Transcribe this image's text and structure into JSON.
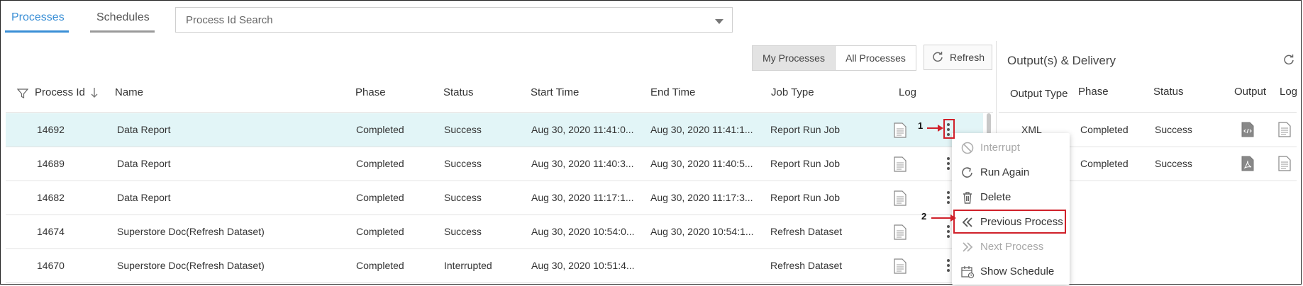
{
  "tabs": [
    {
      "label": "Processes",
      "active": true
    },
    {
      "label": "Schedules",
      "active": false
    }
  ],
  "search": {
    "placeholder": "Process Id Search"
  },
  "filter_buttons": {
    "my_processes": "My Processes",
    "all_processes": "All Processes",
    "refresh": "Refresh"
  },
  "table": {
    "columns": [
      "Process Id",
      "Name",
      "Phase",
      "Status",
      "Start Time",
      "End Time",
      "Job Type",
      "Log"
    ],
    "rows": [
      {
        "id": "14692",
        "name": "Data Report",
        "phase": "Completed",
        "status": "Success",
        "start": "Aug 30, 2020 11:41:0...",
        "end": "Aug 30, 2020 11:41:1...",
        "job_type": "Report Run Job"
      },
      {
        "id": "14689",
        "name": "Data Report",
        "phase": "Completed",
        "status": "Success",
        "start": "Aug 30, 2020 11:40:3...",
        "end": "Aug 30, 2020 11:40:5...",
        "job_type": "Report Run Job"
      },
      {
        "id": "14682",
        "name": "Data Report",
        "phase": "Completed",
        "status": "Success",
        "start": "Aug 30, 2020 11:17:1...",
        "end": "Aug 30, 2020 11:17:3...",
        "job_type": "Report Run Job"
      },
      {
        "id": "14674",
        "name": "Superstore Doc(Refresh Dataset)",
        "phase": "Completed",
        "status": "Success",
        "start": "Aug 30, 2020 10:54:0...",
        "end": "Aug 30, 2020 10:54:1...",
        "job_type": "Refresh Dataset"
      },
      {
        "id": "14670",
        "name": "Superstore Doc(Refresh Dataset)",
        "phase": "Completed",
        "status": "Interrupted",
        "start": "Aug 30, 2020 10:51:4...",
        "end": "",
        "job_type": "Refresh Dataset"
      }
    ]
  },
  "output_panel": {
    "title": "Output(s) & Delivery",
    "columns": [
      "Output Type",
      "Phase",
      "Status",
      "Output",
      "Log"
    ],
    "rows": [
      {
        "type": "XML",
        "phase": "Completed",
        "status": "Success"
      },
      {
        "type": "",
        "phase": "Completed",
        "status": "Success"
      }
    ]
  },
  "context_menu": [
    {
      "label": "Interrupt",
      "icon": "block-icon",
      "enabled": false
    },
    {
      "label": "Run Again",
      "icon": "redo-icon",
      "enabled": true
    },
    {
      "label": "Delete",
      "icon": "trash-icon",
      "enabled": true
    },
    {
      "label": "Previous Process",
      "icon": "double-chevron-left-icon",
      "enabled": true
    },
    {
      "label": "Next Process",
      "icon": "double-chevron-right-icon",
      "enabled": false
    },
    {
      "label": "Show Schedule",
      "icon": "calendar-icon",
      "enabled": true
    }
  ],
  "annotations": {
    "step1": "1",
    "step2": "2"
  },
  "colors": {
    "accent": "#3a8fd6",
    "selected_row": "#e2f5f7",
    "annotation": "#d0202a"
  }
}
